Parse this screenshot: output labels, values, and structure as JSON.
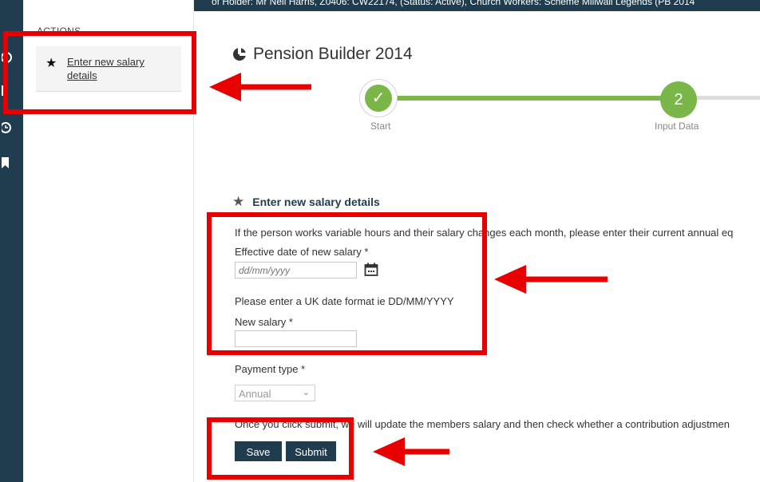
{
  "header": {
    "banner_text": "of Holder: Mr Neil Harris, Z0406: CW22174, (Status: Active), Church Workers: Scheme Millwall Legends (PB 2014"
  },
  "sidebar": {
    "title": "ACTIONS",
    "items": [
      {
        "label": "Enter new salary details",
        "icon": "star-icon"
      }
    ]
  },
  "rail_icons": [
    "circle-icon",
    "document-icon",
    "clock-icon",
    "bookmark-icon"
  ],
  "app": {
    "title": "Pension Builder 2014"
  },
  "stepper": {
    "steps": [
      {
        "number": "✓",
        "label": "Start",
        "state": "complete"
      },
      {
        "number": "2",
        "label": "Input Data",
        "state": "current"
      }
    ],
    "accent_color": "#7ab648"
  },
  "form": {
    "section_title": "Enter new salary details",
    "intro": "If the person works variable hours and their salary changes each month, please enter their current annual eq",
    "effective_date_label": "Effective date of new salary *",
    "effective_date_placeholder": "dd/mm/yyyy",
    "date_hint": "Please enter a UK date format ie DD/MM/YYYY",
    "salary_label": "New salary *",
    "salary_value": "",
    "payment_type_label": "Payment type *",
    "payment_type_value": "Annual",
    "submit_note": "Once you click submit, we will update the members salary and then check whether a contribution adjustmen",
    "save_label": "Save",
    "submit_label": "Submit"
  },
  "colors": {
    "navy": "#1f3d4f",
    "annotation_red": "#e80000"
  }
}
